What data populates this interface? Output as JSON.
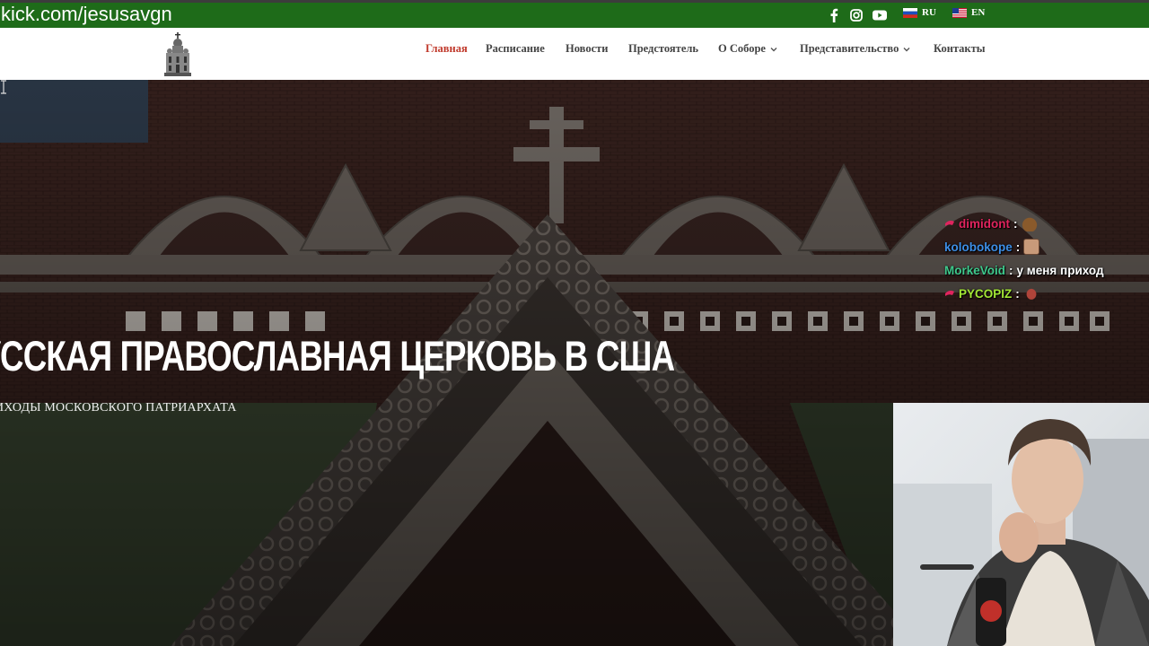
{
  "overlay": {
    "channel_url": "kick.com/jesusavgn"
  },
  "topbar": {
    "social": [
      {
        "name": "facebook-icon"
      },
      {
        "name": "instagram-icon"
      },
      {
        "name": "youtube-icon"
      }
    ],
    "languages": [
      {
        "code": "RU",
        "flag": "russia-flag-icon"
      },
      {
        "code": "EN",
        "flag": "usa-flag-icon"
      }
    ]
  },
  "nav": {
    "items": [
      {
        "label": "Главная",
        "active": true
      },
      {
        "label": "Расписание"
      },
      {
        "label": "Новости"
      },
      {
        "label": "Предстоятель"
      },
      {
        "label": "О Соборе",
        "dropdown": true
      },
      {
        "label": "Представительство",
        "dropdown": true
      },
      {
        "label": "Контакты"
      }
    ]
  },
  "hero": {
    "title": "УССКАЯ ПРАВОСЛАВНАЯ ЦЕРКОВЬ В США",
    "subtitle": "ИХОДЫ МОСКОВСКОГО ПАТРИАРХАТА"
  },
  "chat": {
    "messages": [
      {
        "user": "dimidont",
        "color": "#e0245e",
        "text": "",
        "emote": "poop-emote-icon",
        "badge": true
      },
      {
        "user": "kolobokope",
        "color": "#3d8ee6",
        "text": "",
        "emote": "face-emote-icon",
        "badge": false
      },
      {
        "user": "MorkeVoid",
        "color": "#3fc98c",
        "text": "у меня приход",
        "emote": null,
        "badge": false
      },
      {
        "user": "PYCOPIZ",
        "color": "#a3e635",
        "text": "",
        "emote": "figure-emote-icon",
        "badge": true
      }
    ]
  },
  "colors": {
    "topbar_bg": "#1e6b19",
    "nav_active": "#c0392b",
    "nav_text": "#444444"
  }
}
